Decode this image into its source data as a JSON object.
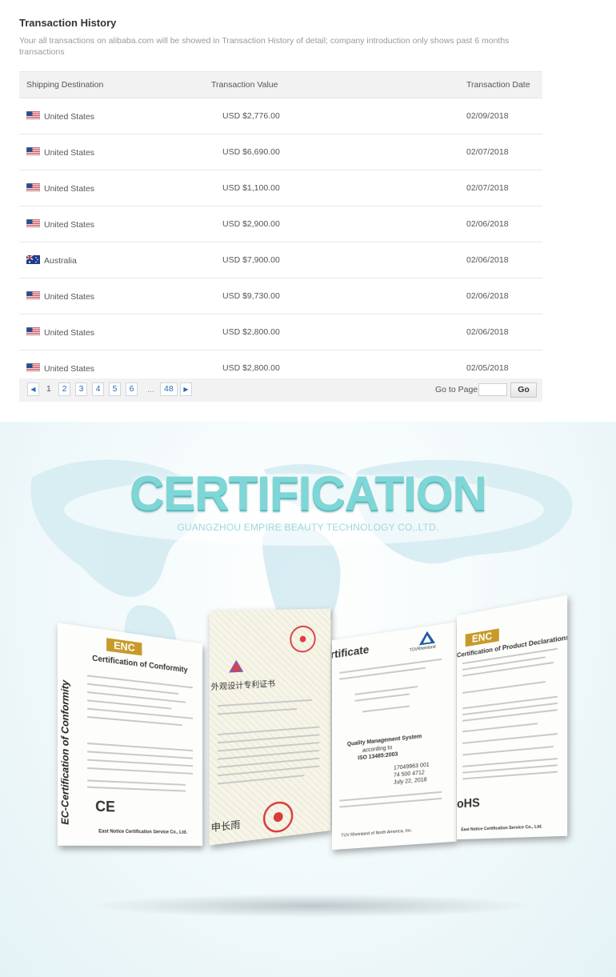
{
  "transaction_history": {
    "title": "Transaction History",
    "description": "Your all transactions on alibaba.com will be showed in Transaction History of detail; company introduction only shows past 6 months transactions",
    "columns": [
      "Shipping Destination",
      "Transaction Value",
      "Transaction Date"
    ],
    "rows": [
      {
        "flag": "us-flag-icon",
        "destination": "United States",
        "value": "USD $2,776.00",
        "date": "02/09/2018"
      },
      {
        "flag": "us-flag-icon",
        "destination": "United States",
        "value": "USD $6,690.00",
        "date": "02/07/2018"
      },
      {
        "flag": "us-flag-icon",
        "destination": "United States",
        "value": "USD $1,100.00",
        "date": "02/07/2018"
      },
      {
        "flag": "us-flag-icon",
        "destination": "United States",
        "value": "USD $2,900.00",
        "date": "02/06/2018"
      },
      {
        "flag": "au-flag-icon",
        "destination": "Australia",
        "value": "USD $7,900.00",
        "date": "02/06/2018"
      },
      {
        "flag": "us-flag-icon",
        "destination": "United States",
        "value": "USD $9,730.00",
        "date": "02/06/2018"
      },
      {
        "flag": "us-flag-icon",
        "destination": "United States",
        "value": "USD $2,800.00",
        "date": "02/06/2018"
      },
      {
        "flag": "us-flag-icon",
        "destination": "United States",
        "value": "USD $2,800.00",
        "date": "02/05/2018"
      }
    ],
    "pagination": {
      "prev_icon": "chevron-left-icon",
      "current": "1",
      "pages": [
        "2",
        "3",
        "4",
        "5",
        "6"
      ],
      "ellipsis": "...",
      "last": "48",
      "next_icon": "chevron-right-icon",
      "goto_label": "Go to Page",
      "goto_value": "",
      "go_button": "Go"
    }
  },
  "certification": {
    "title": "CERTIFICATION",
    "subtitle": "GUANGZHOU EMPIRE BEAUTY TECHNOLOGY CO,.LTD.",
    "documents": [
      {
        "logo": "ENC",
        "heading": "Certification of Conformity",
        "side_text": "EC-Certification of Conformity",
        "mark": "CE",
        "footer": "East Notice Certification Service Co., Ltd."
      },
      {
        "heading": "外观设计专利证书",
        "signature": "申长雨"
      },
      {
        "heading": "rtificate",
        "logo": "TÜVRheinland",
        "body": [
          "Quality Management System",
          "according to",
          "ISO 13485:2003"
        ],
        "report_no": "17049963 001",
        "reg_no": "74 500 4712",
        "date": "July 22, 2018",
        "footer": "TUV Rheinland of North America, Inc."
      },
      {
        "logo": "ENC",
        "heading": "Certification of Product Declarations",
        "mark": "oHS",
        "footer": "East Notice Certification Service Co., Ltd."
      }
    ]
  },
  "colors": {
    "link": "#2a6ab8",
    "header_bg": "#f2f2f2",
    "cert_title": "#7fd6d6"
  }
}
